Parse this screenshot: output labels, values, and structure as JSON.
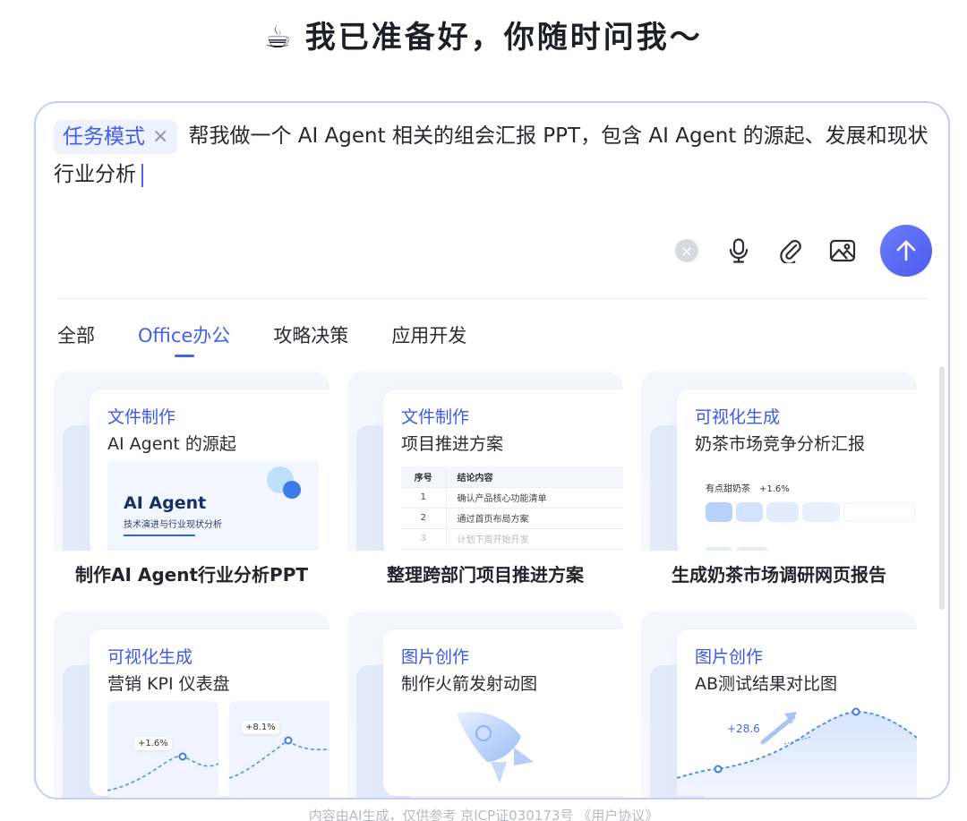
{
  "header": {
    "emoji": "☕",
    "title": "我已准备好，你随时问我～"
  },
  "composer": {
    "mode_chip": "任务模式",
    "mode_chip_close": "×",
    "prompt_text": "帮我做一个 AI Agent 相关的组会汇报 PPT，包含 AI Agent 的源起、发展和现状行业分析",
    "tools": [
      "clear-icon",
      "microphone-icon",
      "attachment-icon",
      "image-icon"
    ],
    "send_icon": "arrow-up-icon",
    "accent": "#4a5bf2"
  },
  "tabs": [
    {
      "label": "全部",
      "active": false
    },
    {
      "label": "Office办公",
      "active": true
    },
    {
      "label": "攻略决策",
      "active": false
    },
    {
      "label": "应用开发",
      "active": false
    }
  ],
  "cards": [
    {
      "tag": "文件制作",
      "subtitle": "AI Agent 的源起",
      "caption": "制作AI Agent行业分析PPT",
      "preview": {
        "title": "AI Agent",
        "subtitle": "技术演进与行业现状分析"
      }
    },
    {
      "tag": "文件制作",
      "subtitle": "项目推进方案",
      "caption": "整理跨部门项目推进方案",
      "preview": {
        "header": [
          "序号",
          "结论内容"
        ],
        "rows": [
          [
            "1",
            "确认产品核心功能清单"
          ],
          [
            "2",
            "通过首页布局方案"
          ],
          [
            "3",
            "计划下周开始开发"
          ]
        ]
      }
    },
    {
      "tag": "可视化生成",
      "subtitle": "奶茶市场竞争分析汇报",
      "caption": "生成奶茶市场调研网页报告",
      "preview": {
        "label": "有点甜奶茶",
        "delta": "+1.6%"
      }
    },
    {
      "tag": "可视化生成",
      "subtitle": "营销 KPI 仪表盘",
      "preview": {
        "delta_a": "+1.6%",
        "delta_b": "+8.1%"
      }
    },
    {
      "tag": "图片创作",
      "subtitle": "制作火箭发射动图",
      "preview": {
        "icon": "rocket-icon"
      }
    },
    {
      "tag": "图片创作",
      "subtitle": "AB测试结果对比图",
      "preview": {
        "value": "+28.6"
      }
    }
  ],
  "footer": {
    "text": "内容由AI生成，仅供参考  京ICP证030173号  ",
    "link": "《用户协议》"
  }
}
